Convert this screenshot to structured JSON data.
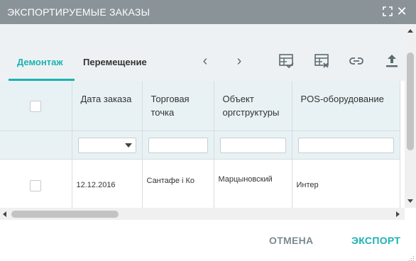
{
  "dialog": {
    "title": "ЭКСПОРТИРУЕМЫЕ ЗАКАЗЫ",
    "maximize_icon": "maximize-icon",
    "close_icon": "close-icon"
  },
  "tabs": [
    {
      "label": "Демонтаж",
      "active": true
    },
    {
      "label": "Перемещение",
      "active": false
    }
  ],
  "nav": {
    "prev": "‹",
    "next": "›"
  },
  "toolbar_icons": [
    "table-check-icon",
    "table-remove-icon",
    "link-icon",
    "upload-icon"
  ],
  "table": {
    "columns": [
      {
        "label": "Дата заказа",
        "filter": "select"
      },
      {
        "label": "Торговая точка",
        "filter": "text"
      },
      {
        "label": "Объект оргструктуры",
        "filter": "text"
      },
      {
        "label": "POS-оборудование",
        "filter": "text"
      }
    ],
    "rows": [
      {
        "date": "12.12.2016",
        "point": "Сантафе і Ко",
        "org_object": "Марцыновский",
        "pos": "Интер"
      }
    ]
  },
  "footer": {
    "cancel_label": "ОТМЕНА",
    "export_label": "ЭКСПОРТ"
  },
  "colors": {
    "accent": "#1bb2b2",
    "titlebar": "#8a9398",
    "header_bg": "#e8f1f4"
  }
}
